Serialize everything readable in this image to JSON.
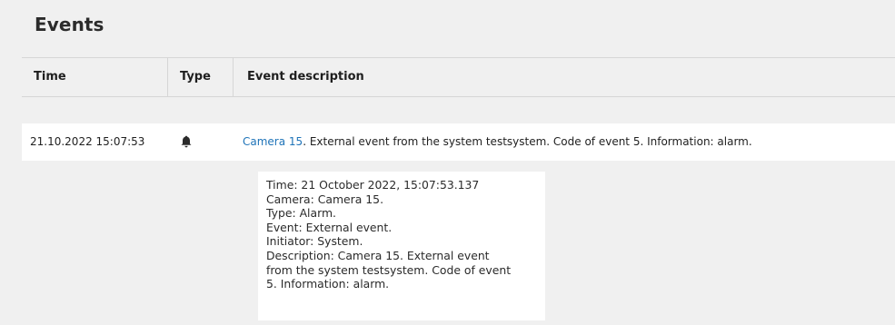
{
  "panel": {
    "title": "Events"
  },
  "table": {
    "columns": [
      "Time",
      "Type",
      "Event description"
    ],
    "rows": [
      {
        "time": "21.10.2022 15:07:53",
        "type_icon": "bell-icon",
        "camera_link": "Camera 15",
        "description_rest": ". External event from the system testsystem. Code of event 5. Information: alarm."
      }
    ]
  },
  "details": {
    "lines": [
      "Time: 21 October 2022, 15:07:53.137",
      "Camera: Camera 15.",
      "Type: Alarm.",
      "Event: External event.",
      "Initiator: System.",
      "Description: Camera 15. External event",
      "from the system testsystem. Code of event",
      "5. Information: alarm."
    ]
  }
}
